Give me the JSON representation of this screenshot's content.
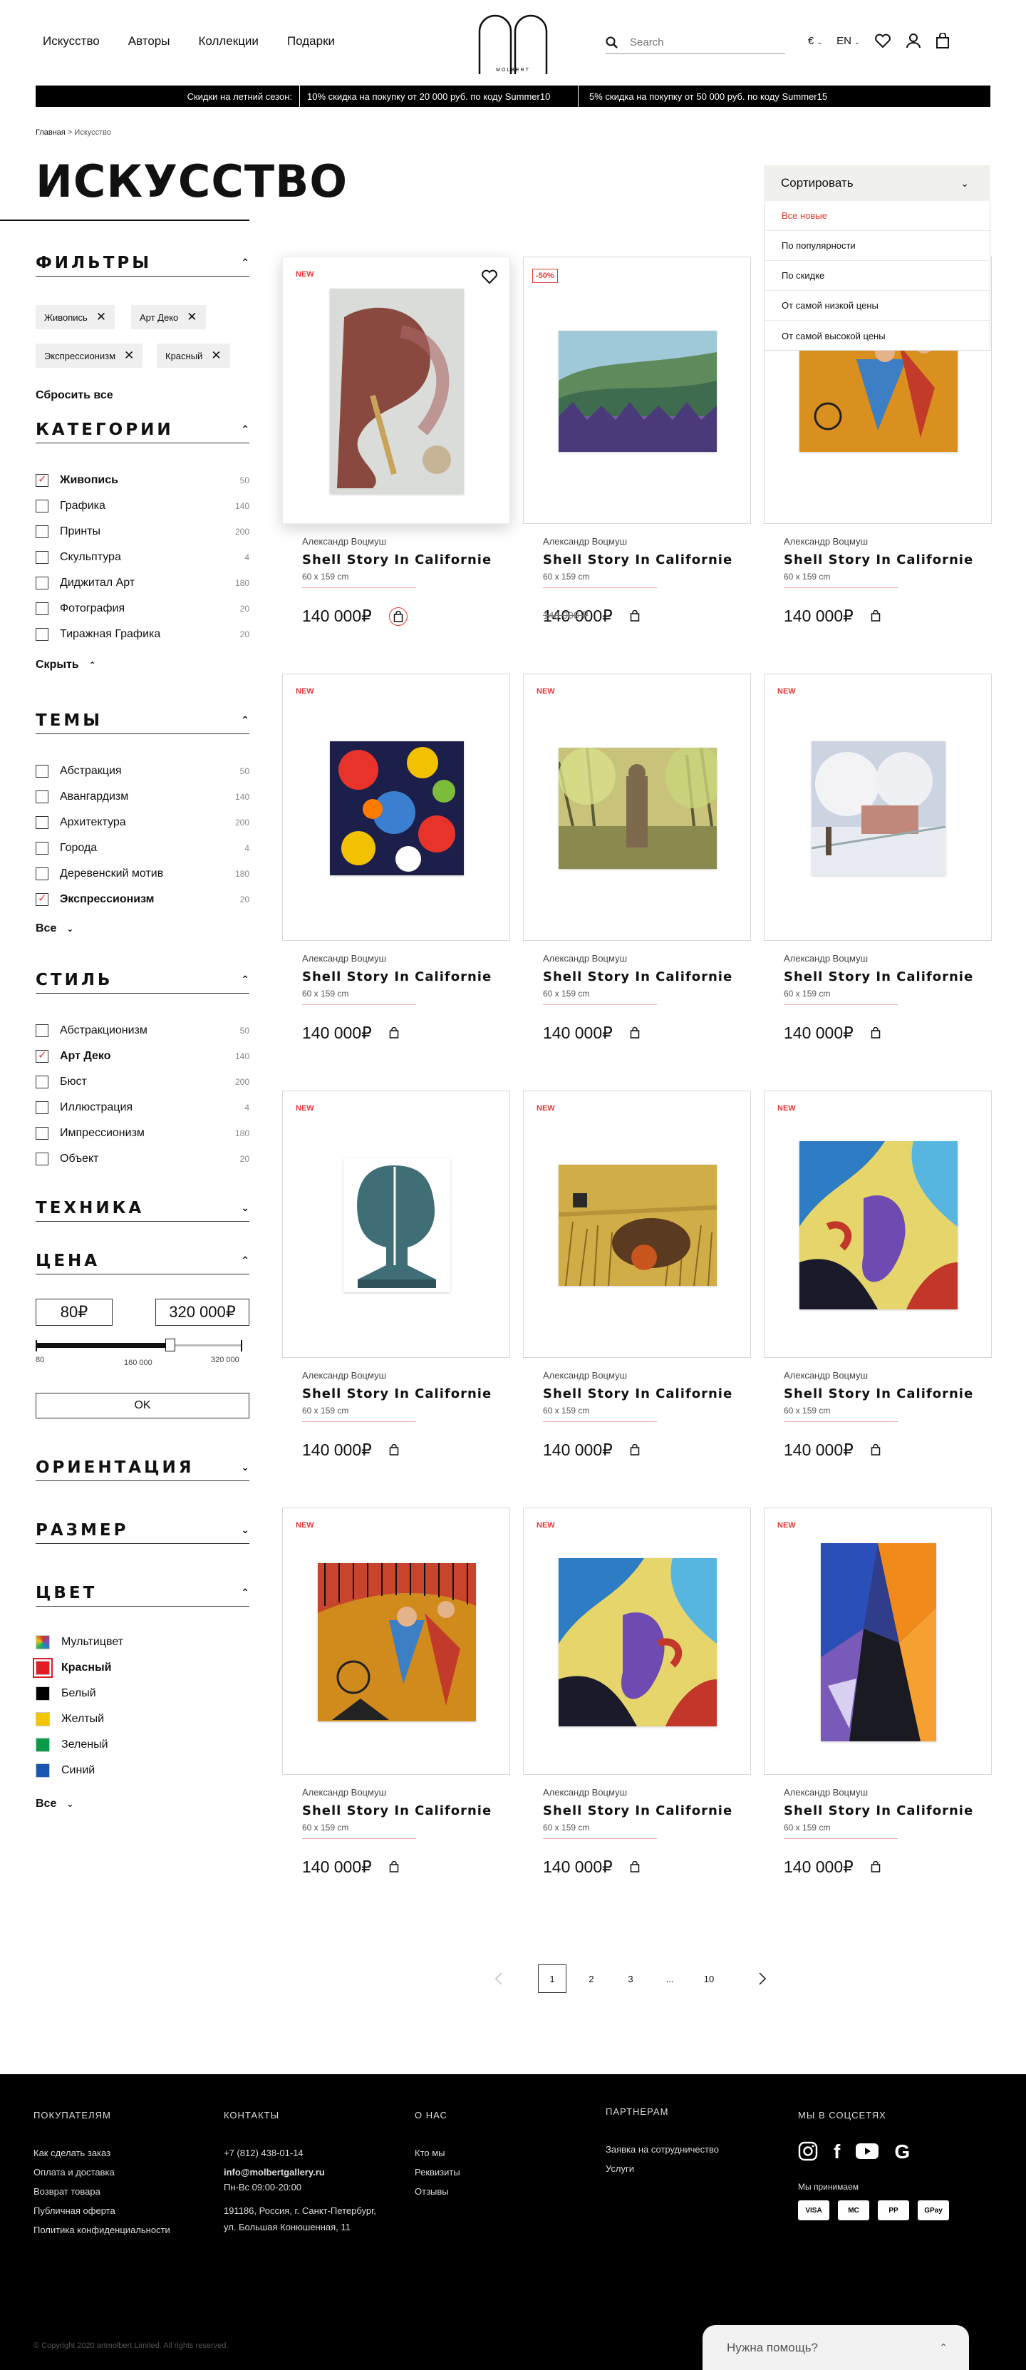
{
  "header": {
    "nav": [
      "Искусство",
      "Авторы",
      "Коллекции",
      "Подарки"
    ],
    "logo_text": "MOLBERT GALLERY",
    "search_placeholder": "Search",
    "currency": "€",
    "language": "EN"
  },
  "promo": {
    "label": "Скидки на летний сезон:",
    "offer1": "10% скидка на покупку от 20 000 руб. по коду Summer10",
    "offer2": "5% скидка на покупку от 50 000 руб. по коду Summer15"
  },
  "breadcrumb": {
    "home": "Главная",
    "sep": " > ",
    "current": "Искусство"
  },
  "page_title": "ИСКУССТВО",
  "sort": {
    "label": "Сортировать",
    "options": [
      "Все новые",
      "По популярности",
      "По скидке",
      "От самой низкой цены",
      "От самой высокой цены"
    ],
    "active": "Все новые"
  },
  "filters": {
    "title": "ФИЛЬТРЫ",
    "chips": [
      "Живопись",
      "Арт Деко",
      "Экспрессионизм",
      "Красный"
    ],
    "reset": "Сбросить все"
  },
  "categories": {
    "title": "КАТЕГОРИИ",
    "items": [
      {
        "label": "Живопись",
        "count": "50",
        "checked": true
      },
      {
        "label": "Графика",
        "count": "140"
      },
      {
        "label": "Принты",
        "count": "200"
      },
      {
        "label": "Скульптура",
        "count": "4"
      },
      {
        "label": "Диджитал Арт",
        "count": "180"
      },
      {
        "label": "Фотография",
        "count": "20"
      },
      {
        "label": "Тиражная Графика",
        "count": "20"
      }
    ],
    "toggle": "Скрыть"
  },
  "themes": {
    "title": "ТЕМЫ",
    "items": [
      {
        "label": "Абстракция",
        "count": "50"
      },
      {
        "label": "Авангардизм",
        "count": "140"
      },
      {
        "label": "Архитектура",
        "count": "200"
      },
      {
        "label": "Города",
        "count": "4"
      },
      {
        "label": "Деревенский мотив",
        "count": "180"
      },
      {
        "label": "Экспрессионизм",
        "count": "20",
        "checked": true
      }
    ],
    "toggle": "Все"
  },
  "style": {
    "title": "СТИЛЬ",
    "items": [
      {
        "label": "Абстракционизм",
        "count": "50"
      },
      {
        "label": "Арт Деко",
        "count": "140",
        "checked": true
      },
      {
        "label": "Бюст",
        "count": "200"
      },
      {
        "label": "Иллюстрация",
        "count": "4"
      },
      {
        "label": "Импрессионизм",
        "count": "180"
      },
      {
        "label": "Объект",
        "count": "20"
      }
    ]
  },
  "technique": {
    "title": "ТЕХНИКА"
  },
  "price": {
    "title": "ЦЕНА",
    "min": "80₽",
    "max": "320 000₽",
    "ticks": [
      "80",
      "160 000",
      "320 000"
    ],
    "ok": "OK",
    "range_min": 0,
    "range_max": 0.65
  },
  "orientation": {
    "title": "ОРИЕНТАЦИЯ"
  },
  "size": {
    "title": "РАЗМЕР"
  },
  "color": {
    "title": "ЦВЕТ",
    "items": [
      {
        "label": "Мультицвет",
        "hex": "multi"
      },
      {
        "label": "Красный",
        "hex": "#e31b23",
        "checked": true
      },
      {
        "label": "Белый",
        "hex": "#000000"
      },
      {
        "label": "Желтый",
        "hex": "#f5c400"
      },
      {
        "label": "Зеленый",
        "hex": "#0a9a4a"
      },
      {
        "label": "Синий",
        "hex": "#1a56b0"
      }
    ],
    "toggle": "Все"
  },
  "products": [
    {
      "badge": "NEW",
      "artist": "Александр Воцмуш",
      "name": "Shell Story In Californie",
      "size": "60 x 159 cm",
      "price": "140 000₽"
    },
    {
      "badge": "-50%",
      "artist": "Александр Воцмуш",
      "name": "Shell Story In Californie",
      "size": "60 x 159 cm",
      "price": "140 000₽",
      "old_price": "140 000 ₽"
    },
    {
      "badge": "",
      "artist": "Александр Воцмуш",
      "name": "Shell Story In Californie",
      "size": "60 x 159 cm",
      "price": "140 000₽"
    },
    {
      "badge": "NEW",
      "artist": "Александр Воцмуш",
      "name": "Shell Story In Californie",
      "size": "60 x 159 cm",
      "price": "140 000₽"
    },
    {
      "badge": "NEW",
      "artist": "Александр Воцмуш",
      "name": "Shell Story In Californie",
      "size": "60 x 159 cm",
      "price": "140 000₽"
    },
    {
      "badge": "NEW",
      "artist": "Александр Воцмуш",
      "name": "Shell Story In Californie",
      "size": "60 x 159 cm",
      "price": "140 000₽"
    },
    {
      "badge": "NEW",
      "artist": "Александр Воцмуш",
      "name": "Shell Story In Californie",
      "size": "60 x 159 cm",
      "price": "140 000₽"
    },
    {
      "badge": "NEW",
      "artist": "Александр Воцмуш",
      "name": "Shell Story In Californie",
      "size": "60 x 159 cm",
      "price": "140 000₽"
    },
    {
      "badge": "NEW",
      "artist": "Александр Воцмуш",
      "name": "Shell Story In Californie",
      "size": "60 x 159 cm",
      "price": "140 000₽"
    },
    {
      "badge": "NEW",
      "artist": "Александр Воцмуш",
      "name": "Shell Story In Californie",
      "size": "60 x 159 cm",
      "price": "140 000₽"
    },
    {
      "badge": "NEW",
      "artist": "Александр Воцмуш",
      "name": "Shell Story In Californie",
      "size": "60 x 159 cm",
      "price": "140 000₽"
    },
    {
      "badge": "NEW",
      "artist": "Александр Воцмуш",
      "name": "Shell Story In Californie",
      "size": "60 x 159 cm",
      "price": "140 000₽"
    }
  ],
  "pagination": {
    "pages": [
      "1",
      "2",
      "3",
      "...",
      "10"
    ],
    "current": "1"
  },
  "footer": {
    "buyers": {
      "title": "ПОКУПАТЕЛЯМ",
      "items": [
        "Как сделать заказ",
        "Оплата и доставка",
        "Возврат товара",
        "Публичная оферта",
        "Политика конфиденциальности"
      ]
    },
    "contacts": {
      "title": "КОНТАКТЫ",
      "phone": "+7 (812) 438-01-14",
      "email": "info@molbertgallery.ru",
      "hours": "Пн-Вс  09:00-20:00",
      "address1": "191186, Россия, г. Санкт-Петербург,",
      "address2": "ул. Большая Конюшенная, 11"
    },
    "about": {
      "title": "О НАС",
      "items": [
        "Кто мы",
        "Реквизиты",
        "Отзывы"
      ]
    },
    "partners": {
      "title": "ПАРТНЕРАМ",
      "items": [
        "Заявка на сотрудничество",
        "Услуги"
      ]
    },
    "social": {
      "title": "МЫ В СОЦСЕТЯХ",
      "accept": "Мы принимаем",
      "payments": [
        "VISA",
        "MC",
        "PP",
        "GPay"
      ]
    },
    "copyright": "© Copyright 2020 artmolbert Limited. All rights reserved.",
    "help": "Нужна помощь?"
  },
  "accent": "#e53935"
}
